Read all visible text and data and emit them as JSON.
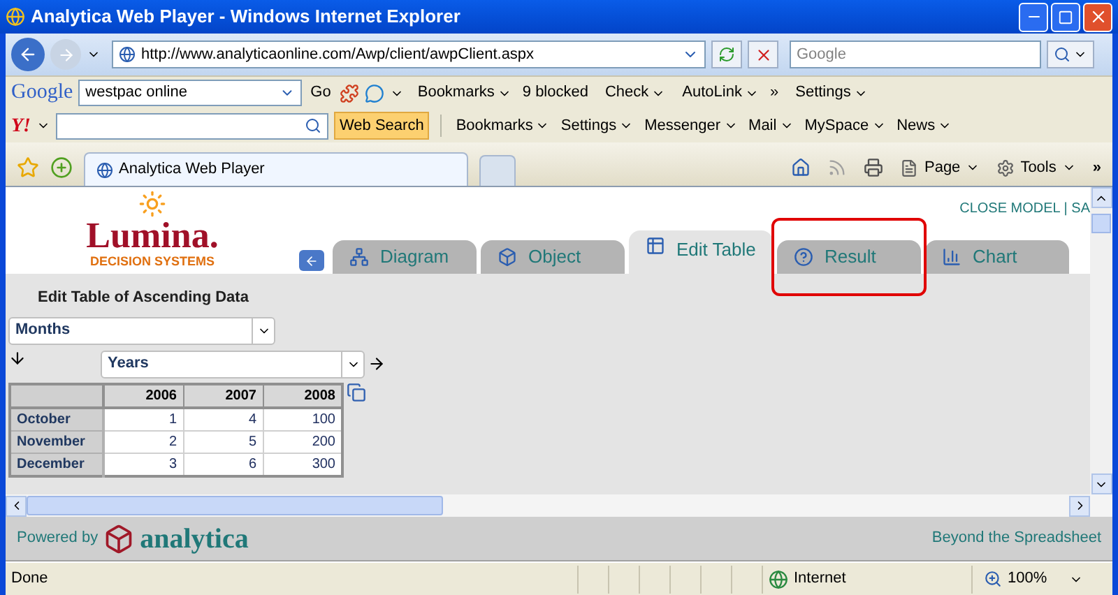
{
  "window": {
    "title": "Analytica Web Player - Windows Internet Explorer"
  },
  "address_bar": {
    "url": "http://www.analyticaonline.com/Awp/client/awpClient.aspx"
  },
  "search_field": {
    "placeholder": "Google"
  },
  "google_toolbar": {
    "logo": "Google",
    "search_value": "westpac online",
    "items": [
      {
        "kind": "text",
        "label": "Go"
      },
      {
        "kind": "icons"
      },
      {
        "kind": "menu",
        "label": "Bookmarks"
      },
      {
        "kind": "text",
        "label": "9 blocked"
      },
      {
        "kind": "menu",
        "label": "Check"
      },
      {
        "kind": "menu",
        "label": "AutoLink"
      },
      {
        "kind": "text",
        "label": "»"
      },
      {
        "kind": "menu",
        "label": "Settings"
      }
    ]
  },
  "yahoo_toolbar": {
    "logo": "Y!",
    "search_button": "Web Search",
    "items": [
      {
        "label": "Bookmarks"
      },
      {
        "label": "Settings"
      },
      {
        "label": "Messenger"
      },
      {
        "label": "Mail"
      },
      {
        "label": "MySpace"
      },
      {
        "label": "News"
      }
    ]
  },
  "browser_tabs": [
    {
      "label": "Analytica Web Player",
      "selected": true
    }
  ],
  "command_bar": {
    "items": [
      {
        "label": "Page"
      },
      {
        "label": "Tools"
      }
    ],
    "more": "»"
  },
  "page": {
    "logo": "Lumina.",
    "logo_tagline": "DECISION SYSTEMS",
    "top_links": "CLOSE MODEL | SA",
    "tabs": [
      {
        "label": "Diagram",
        "selected": false,
        "highlighted": false
      },
      {
        "label": "Object",
        "selected": false,
        "highlighted": false
      },
      {
        "label": "Edit Table",
        "selected": true,
        "highlighted": false
      },
      {
        "label": "Result",
        "selected": false,
        "highlighted": true
      },
      {
        "label": "Chart",
        "selected": false,
        "highlighted": false
      }
    ],
    "table_title": "Edit Table of Ascending Data",
    "row_index": "Months",
    "column_index": "Years",
    "table": {
      "columns": [
        "2006",
        "2007",
        "2008"
      ],
      "rows": [
        {
          "label": "October",
          "cells": [
            "1",
            "4",
            "100"
          ]
        },
        {
          "label": "November",
          "cells": [
            "2",
            "5",
            "200"
          ]
        },
        {
          "label": "December",
          "cells": [
            "3",
            "6",
            "300"
          ]
        }
      ]
    },
    "footer": {
      "powered_by": "Powered by",
      "brand": "analytica",
      "slogan": "Beyond the Spreadsheet"
    }
  },
  "status_bar": {
    "text": "Done",
    "zone": "Internet",
    "zoom": "100%"
  }
}
